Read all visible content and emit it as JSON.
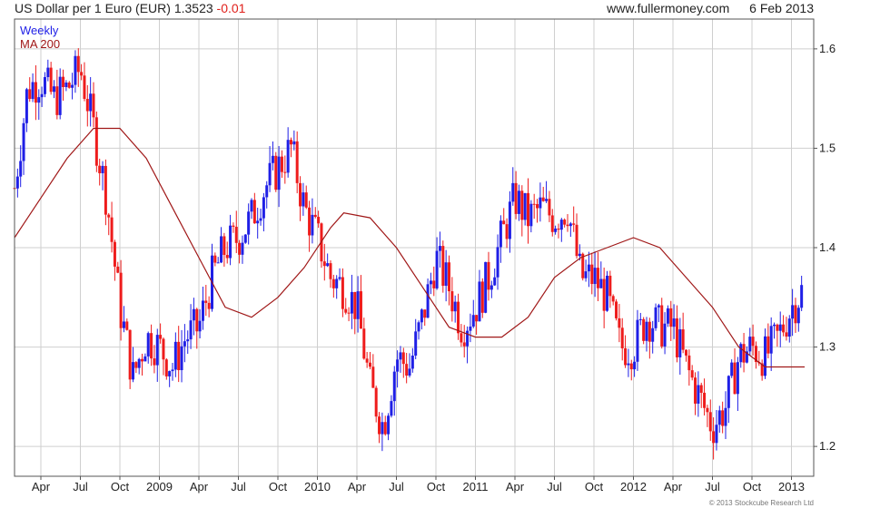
{
  "header": {
    "title": "US Dollar per 1 Euro (EUR)",
    "last_price": "1.3523",
    "change": "-0.01",
    "website": "www.fullermoney.com",
    "date": "6 Feb 2013"
  },
  "footer": {
    "credit": "© 2013 Stockcube Research Ltd"
  },
  "colors": {
    "up": "#1f1fe6",
    "down": "#ee1c1c",
    "ma": "#a01818",
    "grid": "#cfcfcf",
    "frame": "#555555"
  },
  "chart_data": {
    "type": "ohlc",
    "legend": [
      {
        "label": "Weekly",
        "color": "#1f1fe6"
      },
      {
        "label": "MA 200",
        "color": "#a01818"
      }
    ],
    "legend_position": "top-left",
    "grid": true,
    "ylim": [
      1.17,
      1.63
    ],
    "y_ticks": [
      1.2,
      1.3,
      1.4,
      1.5,
      1.6
    ],
    "x_ticks": [
      "Apr",
      "Jul",
      "Oct",
      "2009",
      "Apr",
      "Jul",
      "Oct",
      "2010",
      "Apr",
      "Jul",
      "Oct",
      "2011",
      "Apr",
      "Jul",
      "Oct",
      "2012",
      "Apr",
      "Jul",
      "Oct",
      "2013"
    ],
    "x_range": {
      "start": "2008-02",
      "end": "2013-02"
    },
    "series": [
      {
        "name": "Weekly",
        "style": "candlestick",
        "points": [
          [
            "2008-02",
            1.46
          ],
          [
            "2008-03",
            1.56
          ],
          [
            "2008-04",
            1.57
          ],
          [
            "2008-05",
            1.55
          ],
          [
            "2008-06",
            1.56
          ],
          [
            "2008-07",
            1.58
          ],
          [
            "2008-08",
            1.52
          ],
          [
            "2008-09",
            1.45
          ],
          [
            "2008-10",
            1.34
          ],
          [
            "2008-11",
            1.27
          ],
          [
            "2008-12",
            1.31
          ],
          [
            "2009-01",
            1.3
          ],
          [
            "2009-02",
            1.28
          ],
          [
            "2009-03",
            1.31
          ],
          [
            "2009-04",
            1.32
          ],
          [
            "2009-05",
            1.37
          ],
          [
            "2009-06",
            1.4
          ],
          [
            "2009-07",
            1.41
          ],
          [
            "2009-08",
            1.43
          ],
          [
            "2009-09",
            1.46
          ],
          [
            "2009-10",
            1.48
          ],
          [
            "2009-11",
            1.5
          ],
          [
            "2009-12",
            1.44
          ],
          [
            "2010-01",
            1.41
          ],
          [
            "2010-02",
            1.37
          ],
          [
            "2010-03",
            1.36
          ],
          [
            "2010-04",
            1.34
          ],
          [
            "2010-05",
            1.26
          ],
          [
            "2010-06",
            1.22
          ],
          [
            "2010-07",
            1.29
          ],
          [
            "2010-08",
            1.28
          ],
          [
            "2010-09",
            1.33
          ],
          [
            "2010-10",
            1.39
          ],
          [
            "2010-11",
            1.36
          ],
          [
            "2010-12",
            1.32
          ],
          [
            "2011-01",
            1.34
          ],
          [
            "2011-02",
            1.37
          ],
          [
            "2011-03",
            1.41
          ],
          [
            "2011-04",
            1.45
          ],
          [
            "2011-05",
            1.43
          ],
          [
            "2011-06",
            1.44
          ],
          [
            "2011-07",
            1.43
          ],
          [
            "2011-08",
            1.44
          ],
          [
            "2011-09",
            1.37
          ],
          [
            "2011-10",
            1.37
          ],
          [
            "2011-11",
            1.35
          ],
          [
            "2011-12",
            1.3
          ],
          [
            "2012-01",
            1.3
          ],
          [
            "2012-02",
            1.33
          ],
          [
            "2012-03",
            1.32
          ],
          [
            "2012-04",
            1.32
          ],
          [
            "2012-05",
            1.28
          ],
          [
            "2012-06",
            1.25
          ],
          [
            "2012-07",
            1.22
          ],
          [
            "2012-08",
            1.24
          ],
          [
            "2012-09",
            1.29
          ],
          [
            "2012-10",
            1.3
          ],
          [
            "2012-11",
            1.29
          ],
          [
            "2012-12",
            1.31
          ],
          [
            "2013-01",
            1.34
          ],
          [
            "2013-02",
            1.36
          ]
        ]
      },
      {
        "name": "MA 200",
        "style": "line",
        "points": [
          [
            "2008-02",
            1.41
          ],
          [
            "2008-04",
            1.45
          ],
          [
            "2008-06",
            1.49
          ],
          [
            "2008-08",
            1.52
          ],
          [
            "2008-10",
            1.52
          ],
          [
            "2008-12",
            1.49
          ],
          [
            "2009-02",
            1.44
          ],
          [
            "2009-04",
            1.39
          ],
          [
            "2009-06",
            1.34
          ],
          [
            "2009-08",
            1.33
          ],
          [
            "2009-10",
            1.35
          ],
          [
            "2009-12",
            1.38
          ],
          [
            "2010-02",
            1.42
          ],
          [
            "2010-03",
            1.435
          ],
          [
            "2010-05",
            1.43
          ],
          [
            "2010-07",
            1.4
          ],
          [
            "2010-09",
            1.36
          ],
          [
            "2010-11",
            1.32
          ],
          [
            "2011-01",
            1.31
          ],
          [
            "2011-03",
            1.31
          ],
          [
            "2011-05",
            1.33
          ],
          [
            "2011-07",
            1.37
          ],
          [
            "2011-09",
            1.39
          ],
          [
            "2011-11",
            1.4
          ],
          [
            "2012-01",
            1.41
          ],
          [
            "2012-03",
            1.4
          ],
          [
            "2012-05",
            1.37
          ],
          [
            "2012-07",
            1.34
          ],
          [
            "2012-09",
            1.3
          ],
          [
            "2012-11",
            1.28
          ],
          [
            "2013-02",
            1.28
          ]
        ]
      }
    ]
  }
}
